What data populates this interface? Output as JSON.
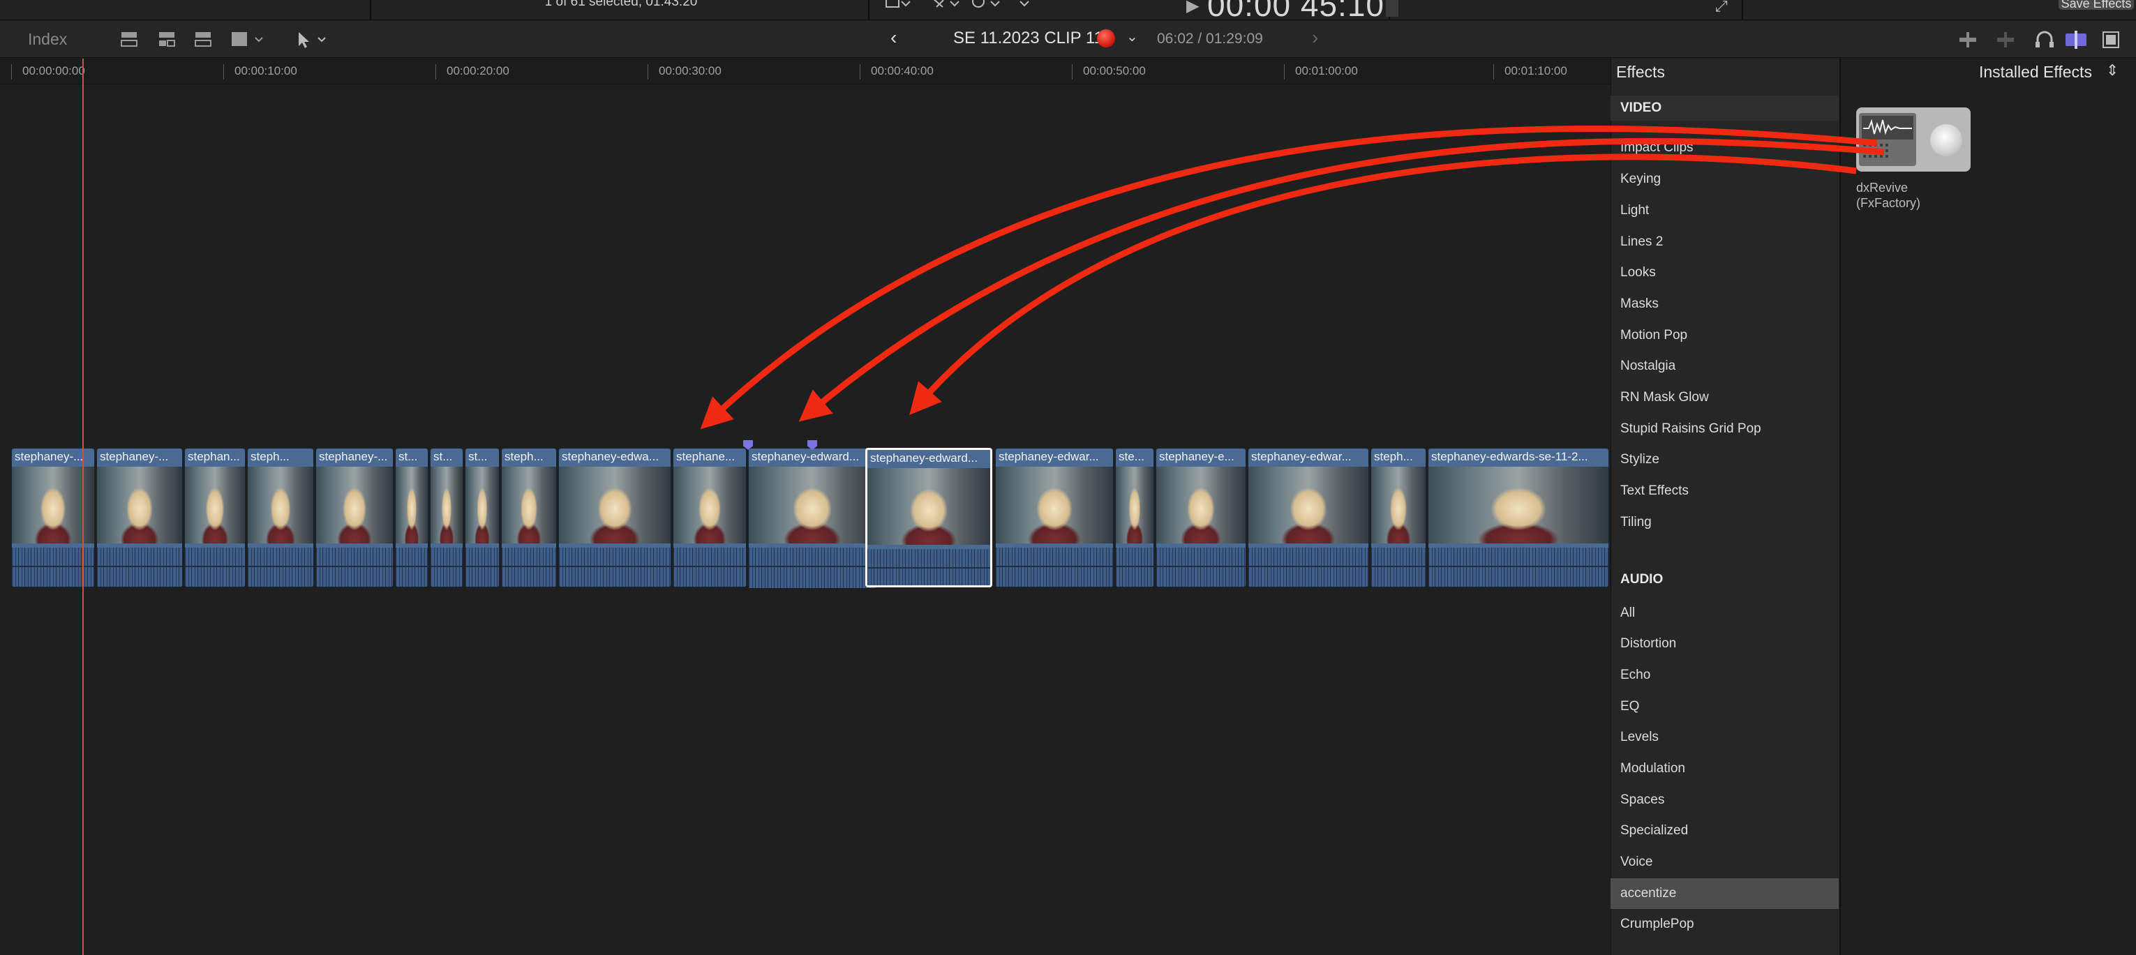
{
  "top": {
    "selection_info": "1 of 61 selected, 01:43:20",
    "timecode": "00:00 45:10",
    "save_effects": "Save Effects"
  },
  "toolbar": {
    "index_label": "Index",
    "project_name": "SE 11.2023 CLIP 11",
    "project_time": "06:02 / 01:29:09"
  },
  "ruler": {
    "labels": [
      "00:00:00:00",
      "00:00:10:00",
      "00:00:20:00",
      "00:00:30:00",
      "00:00:40:00",
      "00:00:50:00",
      "00:01:00:00",
      "00:01:10:00"
    ]
  },
  "timeline": {
    "clips": [
      {
        "title": "stephaney-..."
      },
      {
        "title": "stephaney-..."
      },
      {
        "title": "stephan..."
      },
      {
        "title": "steph..."
      },
      {
        "title": "stephaney-..."
      },
      {
        "title": "st..."
      },
      {
        "title": "st..."
      },
      {
        "title": "st..."
      },
      {
        "title": "steph..."
      },
      {
        "title": "stephaney-edwa..."
      },
      {
        "title": "stephane..."
      },
      {
        "title": "stephaney-edward..."
      },
      {
        "title": "stephaney-edward..."
      },
      {
        "title": "stephaney-edwar..."
      },
      {
        "title": "ste..."
      },
      {
        "title": "stephaney-e..."
      },
      {
        "title": "stephaney-edwar..."
      },
      {
        "title": "steph..."
      },
      {
        "title": "stephaney-edwards-se-11-2..."
      }
    ],
    "selected_clip_index": 12
  },
  "effects": {
    "header": "Effects",
    "video_heading": "VIDEO",
    "video_categories": [
      "Impact Clips",
      "Keying",
      "Light",
      "Lines 2",
      "Looks",
      "Masks",
      "Motion Pop",
      "Nostalgia",
      "RN Mask Glow",
      "Stupid Raisins Grid Pop",
      "Stylize",
      "Text Effects",
      "Tiling"
    ],
    "audio_heading": "AUDIO",
    "audio_categories": [
      "All",
      "Distortion",
      "Echo",
      "EQ",
      "Levels",
      "Modulation",
      "Spaces",
      "Specialized",
      "Voice",
      "accentize",
      "CrumplePop"
    ],
    "active_category": "accentize"
  },
  "browser": {
    "installed_label": "Installed Effects",
    "effect_name_line1": "dxRevive",
    "effect_name_line2": "(FxFactory)"
  },
  "colors": {
    "arrow": "#f02a12",
    "playhead": "#c05a36",
    "clip_blue": "#4a6a94"
  }
}
